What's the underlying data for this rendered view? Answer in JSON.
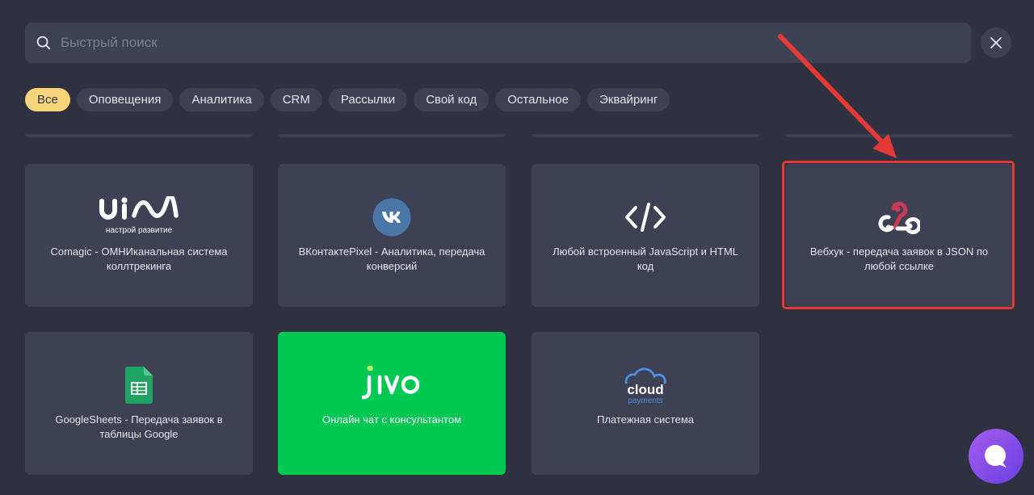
{
  "search": {
    "placeholder": "Быстрый поиск",
    "value": ""
  },
  "icons": {
    "search": "search-icon",
    "close": "close-icon",
    "chat": "chat-icon"
  },
  "filters": [
    {
      "label": "Все",
      "active": true
    },
    {
      "label": "Оповещения"
    },
    {
      "label": "Аналитика"
    },
    {
      "label": "CRM"
    },
    {
      "label": "Рассылки"
    },
    {
      "label": "Свой код"
    },
    {
      "label": "Остальное"
    },
    {
      "label": "Эквайринг"
    }
  ],
  "cards": [
    {
      "logo": "uis-logo",
      "logo_tagline": "настрой развитие",
      "label": "Comagic - ОМНИканальная система коллтрекинга"
    },
    {
      "logo": "vk-logo",
      "label": "ВКонтактеPixel - Аналитика, передача конверсий"
    },
    {
      "logo": "code-icon",
      "label": "Любой встроенный JavaScript и HTML код"
    },
    {
      "logo": "webhook-icon",
      "label": "Вебхук - передача заявок в JSON по любой ссылке",
      "highlighted": true
    },
    {
      "logo": "google-sheets-icon",
      "label": "GoogleSheets - Передача заявок в таблицы Google"
    },
    {
      "logo": "jivo-logo",
      "label": "Онлайн чат с консультантом"
    },
    {
      "logo": "cloudpayments-logo",
      "logo_title": "cloud",
      "logo_subtitle": "payments",
      "label": "Платежная система"
    }
  ],
  "colors": {
    "background": "#2f3140",
    "card": "#3e4054",
    "active_chip": "#f7d57a",
    "jivo_green": "#00c853",
    "annotation_red": "#e53935",
    "chat_purple": "#8b4fe8"
  }
}
